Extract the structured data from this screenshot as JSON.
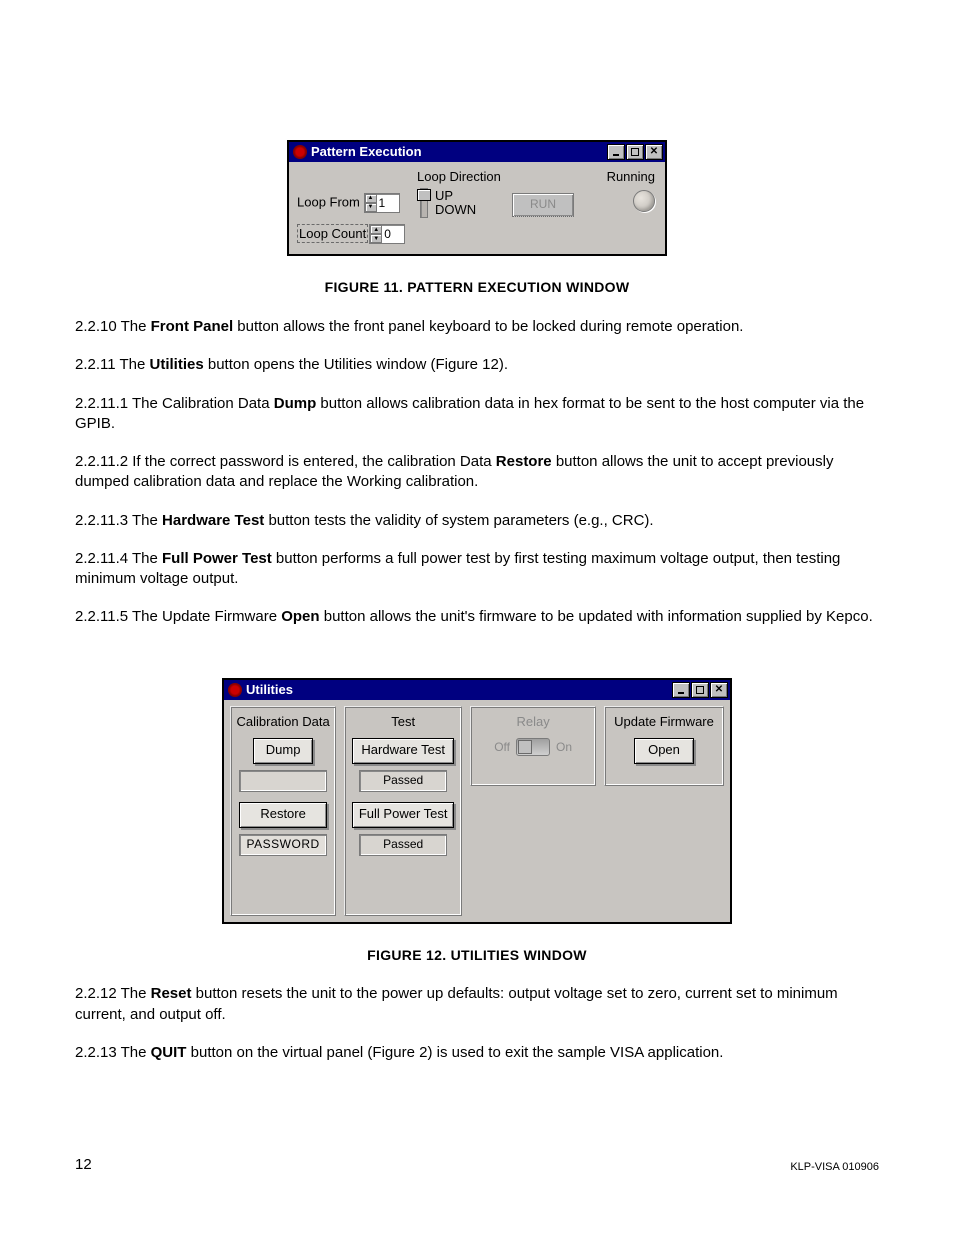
{
  "fig11": {
    "caption": "FIGURE 11.    PATTERN EXECUTION WINDOW",
    "title": "Pattern Execution",
    "loopFromLabel": "Loop From",
    "loopFromValue": "1",
    "loopCountLabel": "Loop Count",
    "loopCountValue": "0",
    "loopDirectionLabel": "Loop Direction",
    "upLabel": "UP",
    "downLabel": "DOWN",
    "runLabel": "RUN",
    "runningLabel": "Running"
  },
  "fig12": {
    "caption": "FIGURE 12.    UTILITIES WINDOW",
    "title": "Utilities",
    "calHeader": "Calibration Data",
    "dumpLabel": "Dump",
    "restoreLabel": "Restore",
    "passwordPlaceholder": "PASSWORD",
    "testHeader": "Test",
    "hwTestLabel": "Hardware Test",
    "hwTestStatus": "Passed",
    "fpTestLabel": "Full Power Test",
    "fpTestStatus": "Passed",
    "relayHeader": "Relay",
    "offLabel": "Off",
    "onLabel": "On",
    "fwHeader": "Update Firmware",
    "openLabel": "Open"
  },
  "text": {
    "p1a": "2.2.10 The ",
    "p1b": "Front Panel",
    "p1c": " button allows the front panel keyboard to be locked during remote operation.",
    "p2a": "2.2.11 The ",
    "p2b": "Utilities",
    "p2c": " button opens the Utilities window (Figure 12).",
    "p3a": "2.2.11.1  The Calibration Data ",
    "p3b": "Dump",
    "p3c": " button allows calibration data in hex format to be sent to the host computer via the GPIB.",
    "p4a": "2.2.11.2  If the correct password is entered, the calibration Data ",
    "p4b": "Restore",
    "p4c": " button allows the unit to accept previously dumped calibration data and replace the Working calibration.",
    "p5a": "2.2.11.3  The ",
    "p5b": "Hardware Test",
    "p5c": " button tests the validity of system parameters (e.g., CRC).",
    "p6a": "2.2.11.4  The ",
    "p6b": "Full Power Test",
    "p6c": " button performs a full power test by first testing maximum voltage output, then testing minimum voltage output.",
    "p7a": "2.2.11.5  The Update Firmware ",
    "p7b": "Open",
    "p7c": " button allows the unit's firmware to be updated with information supplied by Kepco.",
    "p8a": "2.2.12 The ",
    "p8b": "Reset",
    "p8c": " button resets the unit to the power up defaults: output voltage set to zero, current set to minimum current, and output off.",
    "p9a": "2.2.13 The ",
    "p9b": "QUIT",
    "p9c": " button on the virtual panel (Figure 2) is used to exit the sample VISA application."
  },
  "footer": {
    "page": "12",
    "doc": "KLP-VISA 010906"
  }
}
